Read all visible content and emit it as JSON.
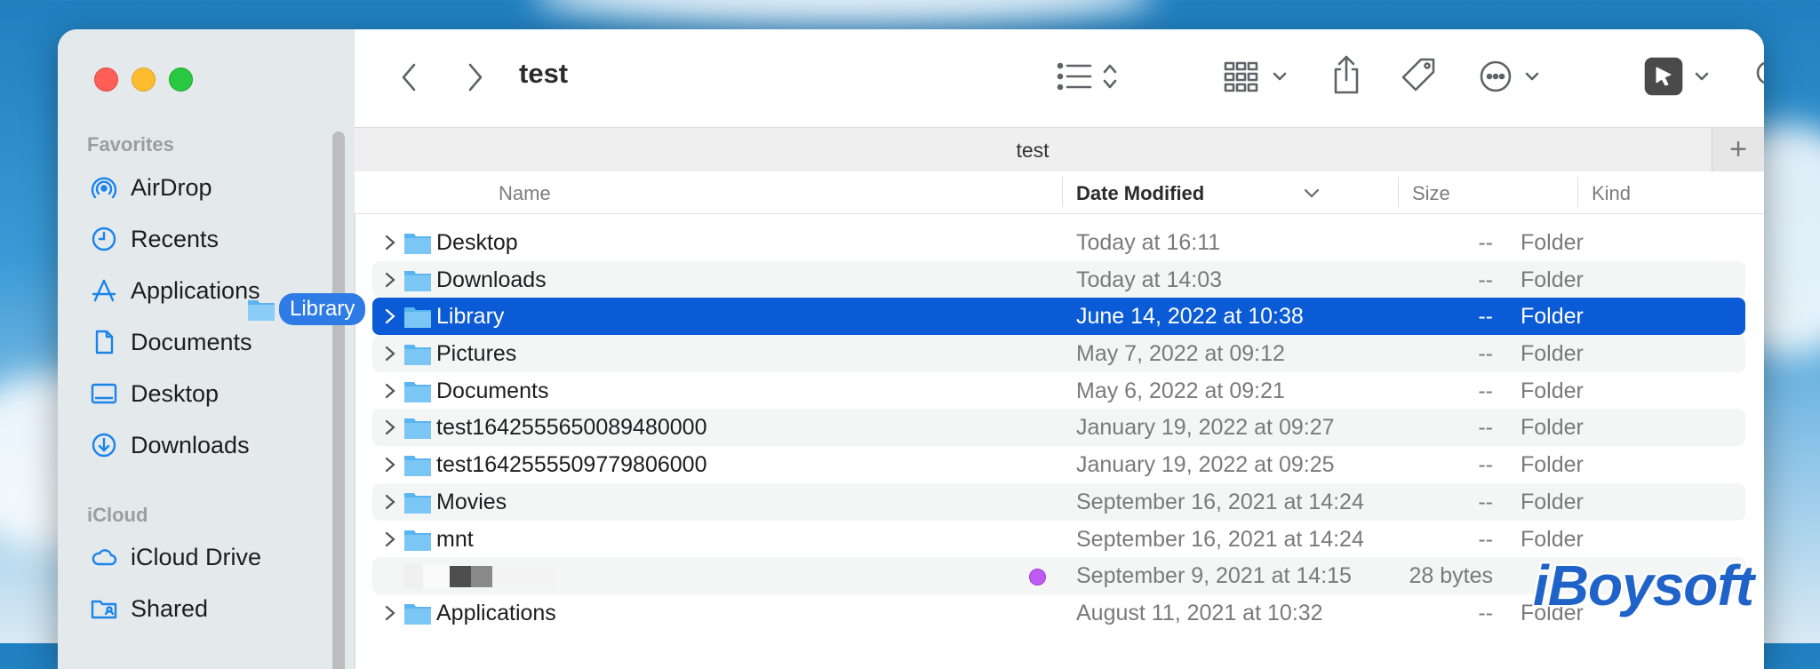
{
  "window": {
    "title": "test"
  },
  "tab": {
    "label": "test",
    "add": "+"
  },
  "sidebar": {
    "favorites_header": "Favorites",
    "icloud_header": "iCloud",
    "items": [
      {
        "label": "AirDrop",
        "icon": "airdrop-icon"
      },
      {
        "label": "Recents",
        "icon": "clock-icon"
      },
      {
        "label": "Applications",
        "icon": "applications-icon"
      },
      {
        "label": "Documents",
        "icon": "document-icon"
      },
      {
        "label": "Desktop",
        "icon": "desktop-icon"
      },
      {
        "label": "Downloads",
        "icon": "download-icon"
      }
    ],
    "icloud_items": [
      {
        "label": "iCloud Drive",
        "icon": "cloud-icon"
      },
      {
        "label": "Shared",
        "icon": "shared-folder-icon"
      }
    ]
  },
  "drag": {
    "label": "Library"
  },
  "columns": {
    "name": "Name",
    "date": "Date Modified",
    "size": "Size",
    "kind": "Kind"
  },
  "rows": [
    {
      "name": "Desktop",
      "date": "Today at 16:11",
      "size": "--",
      "kind": "Folder"
    },
    {
      "name": "Downloads",
      "date": "Today at 14:03",
      "size": "--",
      "kind": "Folder"
    },
    {
      "name": "Library",
      "date": "June 14, 2022 at 10:38",
      "size": "--",
      "kind": "Folder"
    },
    {
      "name": "Pictures",
      "date": "May 7, 2022 at 09:12",
      "size": "--",
      "kind": "Folder"
    },
    {
      "name": "Documents",
      "date": "May 6, 2022 at 09:21",
      "size": "--",
      "kind": "Folder"
    },
    {
      "name": "test1642555650089480000",
      "date": "January 19, 2022 at 09:27",
      "size": "--",
      "kind": "Folder"
    },
    {
      "name": "test1642555509779806000",
      "date": "January 19, 2022 at 09:25",
      "size": "--",
      "kind": "Folder"
    },
    {
      "name": "Movies",
      "date": "September 16, 2021 at 14:24",
      "size": "--",
      "kind": "Folder"
    },
    {
      "name": "mnt",
      "date": "September 16, 2021 at 14:24",
      "size": "--",
      "kind": "Folder"
    },
    {
      "name": "",
      "date": "September 9, 2021 at 14:15",
      "size": "28 bytes",
      "kind": ""
    },
    {
      "name": "Applications",
      "date": "August 11, 2021 at 10:32",
      "size": "--",
      "kind": "Folder"
    }
  ],
  "colors": {
    "selection": "#0b5ad6",
    "accent": "#1a84e8",
    "tag": "#bf5af2"
  },
  "watermark": "iBoysoft"
}
